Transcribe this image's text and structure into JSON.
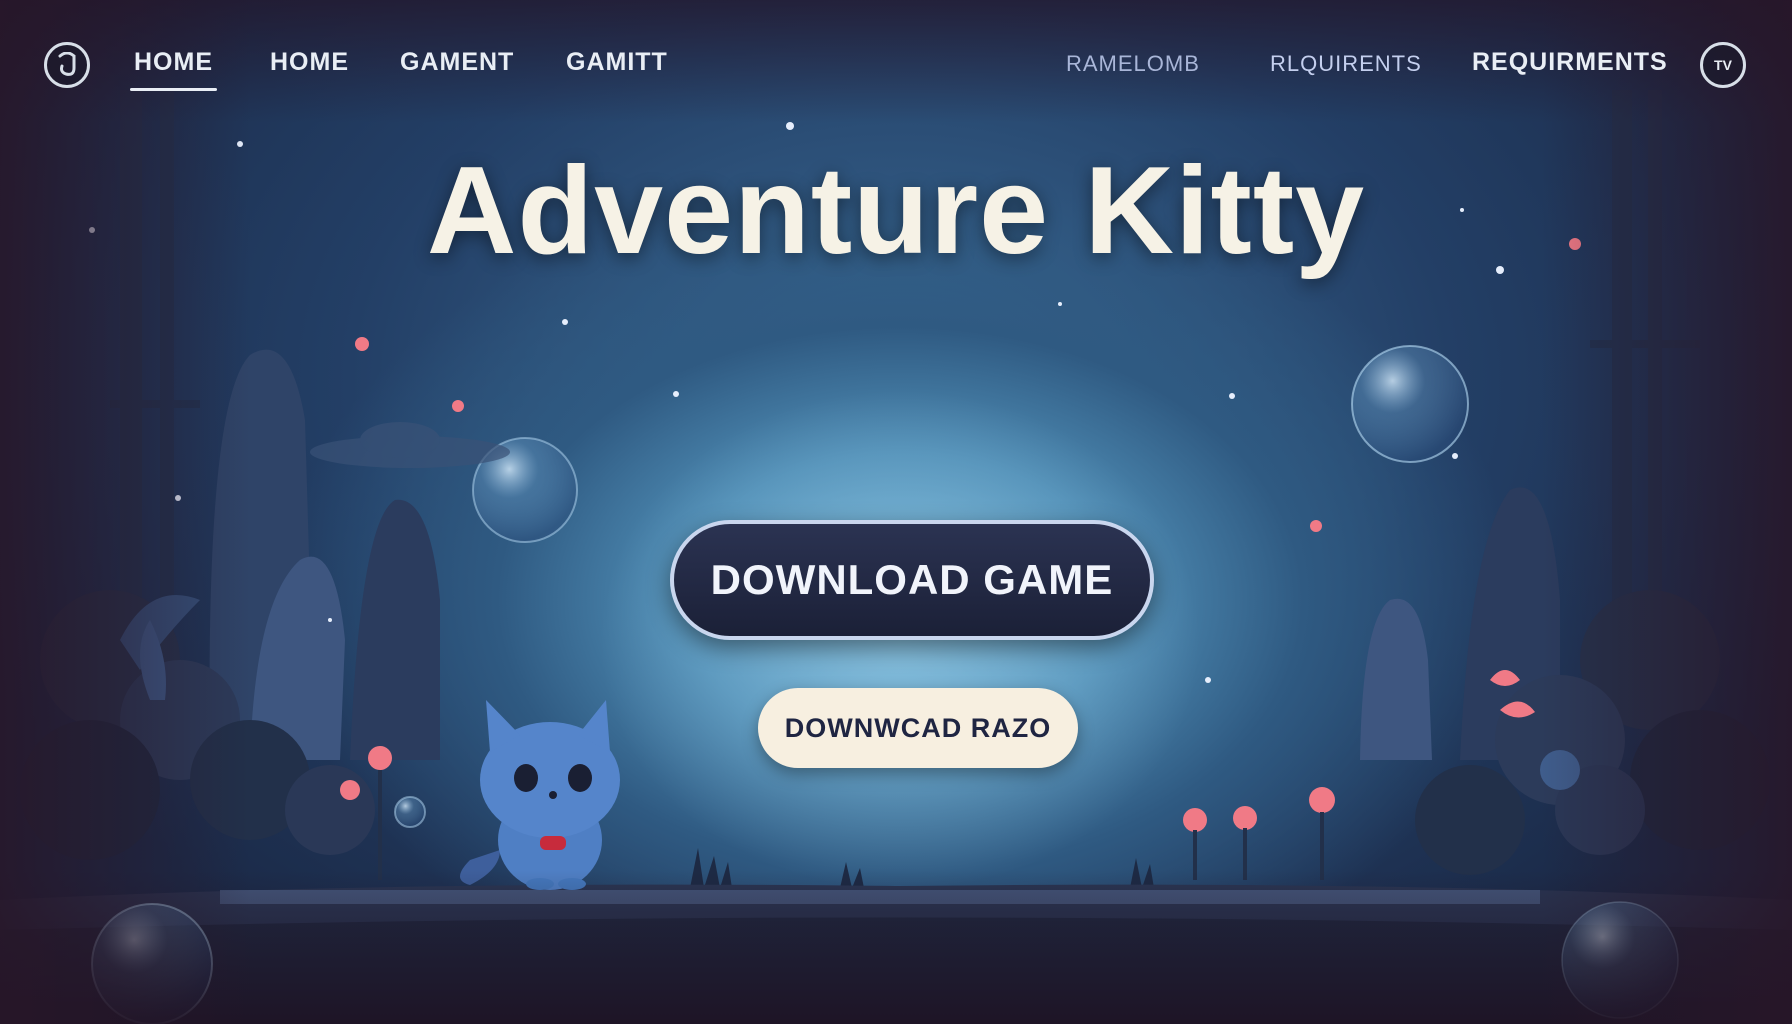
{
  "nav": {
    "logo_icon": "gamepad-logo-icon",
    "items": [
      {
        "label": "HOME"
      },
      {
        "label": "HOME"
      },
      {
        "label": "GAMENT"
      },
      {
        "label": "GAMITT"
      },
      {
        "label": "RAMELOMB"
      },
      {
        "label": "RLQUIRENTS"
      },
      {
        "label": "REQUIRMENTS"
      }
    ],
    "avatar_label": "TV"
  },
  "hero": {
    "title": "Adventure Kitty",
    "primary_button": "DOWNLOAD GAME",
    "secondary_button": "DOWNWCAD RAZO"
  },
  "colors": {
    "sky_center": "#6fb0d4",
    "sky_dark": "#1b2a48",
    "title_text": "#f6f2e6",
    "primary_button_bg": "#1b2037",
    "secondary_button_bg": "#f7efe0",
    "flower_pink": "#f07a86",
    "kitty_body": "#4f7fc4",
    "kitty_collar": "#c72b3c"
  }
}
